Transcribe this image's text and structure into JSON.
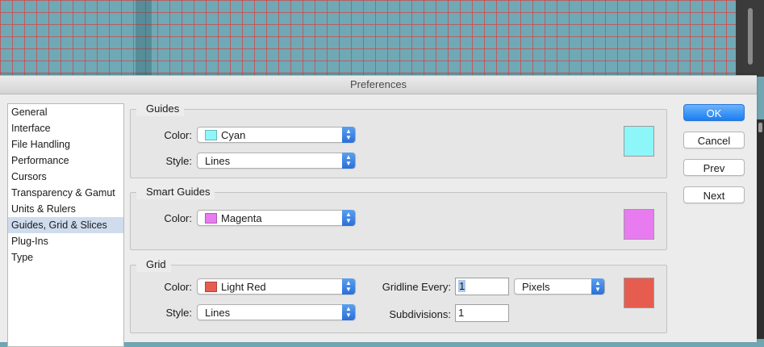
{
  "window": {
    "title": "Preferences"
  },
  "sidebar": {
    "items": [
      {
        "label": "General",
        "selected": false
      },
      {
        "label": "Interface",
        "selected": false
      },
      {
        "label": "File Handling",
        "selected": false
      },
      {
        "label": "Performance",
        "selected": false
      },
      {
        "label": "Cursors",
        "selected": false
      },
      {
        "label": "Transparency & Gamut",
        "selected": false
      },
      {
        "label": "Units & Rulers",
        "selected": false
      },
      {
        "label": "Guides, Grid & Slices",
        "selected": true
      },
      {
        "label": "Plug-Ins",
        "selected": false
      },
      {
        "label": "Type",
        "selected": false
      }
    ]
  },
  "guides": {
    "title": "Guides",
    "color_label": "Color:",
    "color_value": "Cyan",
    "color_hex": "#8df6f9",
    "style_label": "Style:",
    "style_value": "Lines"
  },
  "smart_guides": {
    "title": "Smart Guides",
    "color_label": "Color:",
    "color_value": "Magenta",
    "color_hex": "#e87bef"
  },
  "grid": {
    "title": "Grid",
    "color_label": "Color:",
    "color_value": "Light Red",
    "color_hex": "#e65d4f",
    "style_label": "Style:",
    "style_value": "Lines",
    "gridline_label": "Gridline Every:",
    "gridline_value": "1",
    "gridline_unit": "Pixels",
    "subdivisions_label": "Subdivisions:",
    "subdivisions_value": "1"
  },
  "buttons": {
    "ok": "OK",
    "cancel": "Cancel",
    "prev": "Prev",
    "next": "Next"
  },
  "colors": {
    "accent": "#1a7ef2",
    "canvas": "#6fa9b6",
    "canvas_grid": "#d24646"
  }
}
